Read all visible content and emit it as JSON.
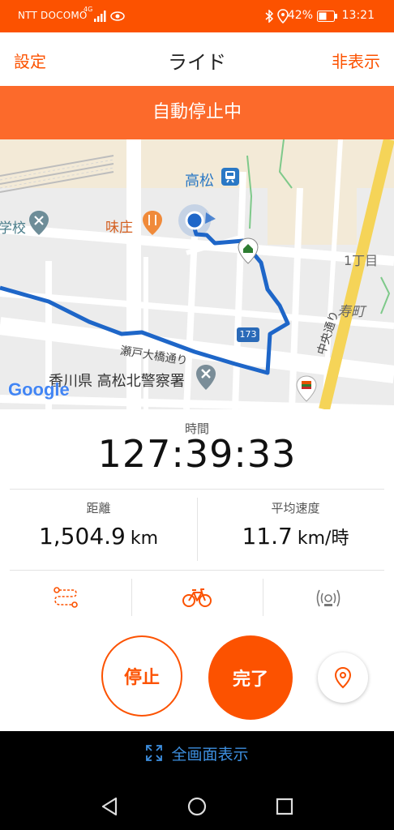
{
  "status_bar": {
    "carrier": "NTT DOCOMO",
    "network": "4G",
    "battery": "42%",
    "time": "13:21"
  },
  "nav": {
    "settings_label": "設定",
    "title": "ライド",
    "hide_label": "非表示"
  },
  "banner": {
    "text": "自動停止中"
  },
  "map": {
    "labels": {
      "station": "高松",
      "restaurant": "味庄",
      "school": "学校",
      "district_1": "1丁目",
      "district_2": "寿町",
      "street_1": "瀬戸大橋通り",
      "street_2": "中央通り",
      "police": "香川県 高松北警察署",
      "route_number": "173",
      "google": "Google"
    },
    "colors": {
      "route": "#1e66c8",
      "road": "#ffffff",
      "base": "#ececec",
      "yellow_road": "#f5d458"
    }
  },
  "stats": {
    "time_label": "時間",
    "time_value": "127:39:33",
    "distance_label": "距離",
    "distance_value": "1,504.9",
    "distance_unit": "km",
    "speed_label": "平均速度",
    "speed_value": "11.7",
    "speed_unit": "km/時"
  },
  "tabs": [
    {
      "icon": "route-icon"
    },
    {
      "icon": "bike-icon"
    },
    {
      "icon": "sensor-icon"
    }
  ],
  "buttons": {
    "stop_label": "停止",
    "finish_label": "完了"
  },
  "fullscreen_label": "全画面表示",
  "accent_color": "#fc5200"
}
